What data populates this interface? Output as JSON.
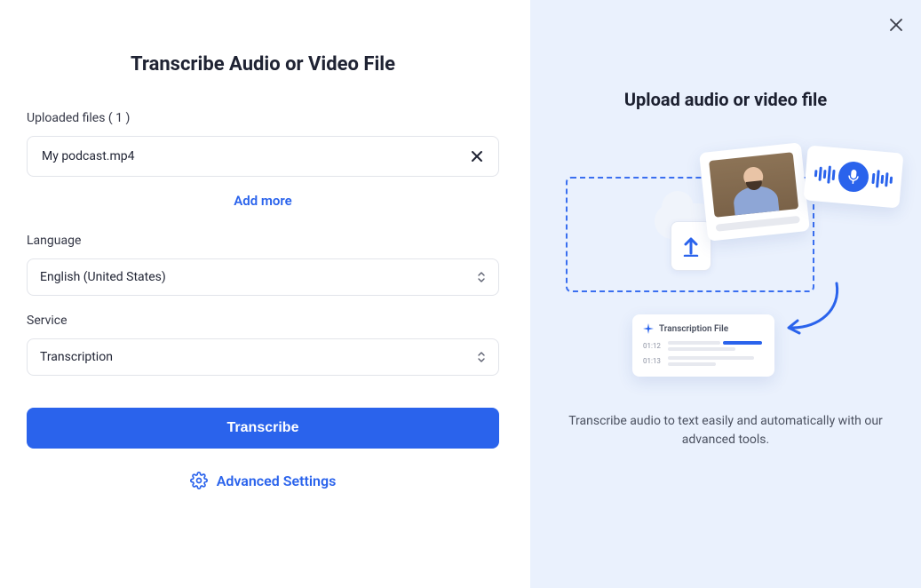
{
  "left": {
    "title": "Transcribe Audio or Video File",
    "uploaded_label": "Uploaded files ( 1 )",
    "file_name": "My podcast.mp4",
    "add_more": "Add more",
    "language_label": "Language",
    "language_value": "English (United States)",
    "service_label": "Service",
    "service_value": "Transcription",
    "transcribe_btn": "Transcribe",
    "advanced_settings": "Advanced Settings"
  },
  "right": {
    "title": "Upload audio or video file",
    "transcript_card_title": "Transcription File",
    "time1": "01:12",
    "time2": "01:13",
    "subtext": "Transcribe audio to text easily and automatically with our advanced tools."
  }
}
